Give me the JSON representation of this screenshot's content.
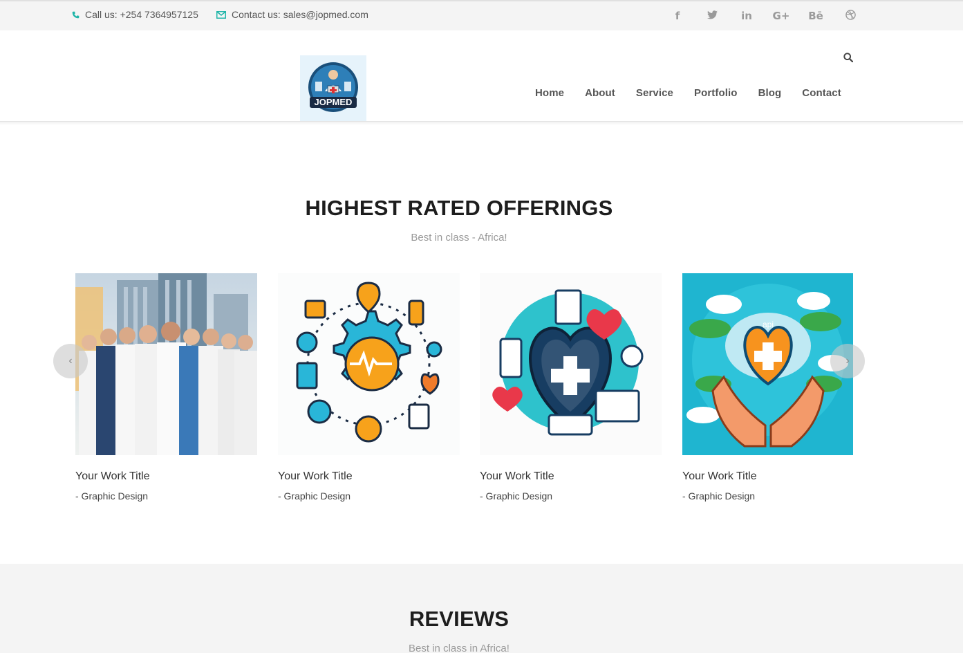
{
  "topbar": {
    "phone": "Call us: +254 7364957125",
    "email": "Contact us: sales@jopmed.com",
    "social": [
      "f",
      "t",
      "in",
      "G+",
      "Bē",
      "dribbble"
    ]
  },
  "header": {
    "logo_text": "JOPMED",
    "nav": [
      "Home",
      "About",
      "Service",
      "Portfolio",
      "Blog",
      "Contact"
    ]
  },
  "offerings": {
    "title": "HIGHEST RATED OFFERINGS",
    "subtitle": "Best in class - Africa!",
    "items": [
      {
        "title": "Your Work Title",
        "category": "- Graphic Design"
      },
      {
        "title": "Your Work Title",
        "category": "- Graphic Design"
      },
      {
        "title": "Your Work Title",
        "category": "- Graphic Design"
      },
      {
        "title": "Your Work Title",
        "category": "- Graphic Design"
      }
    ]
  },
  "reviews": {
    "title": "REVIEWS",
    "subtitle": "Best in class in Africa!"
  },
  "colors": {
    "accent": "#1fb5a8",
    "heading": "#1d1d1d",
    "muted": "#9a9a9a"
  }
}
